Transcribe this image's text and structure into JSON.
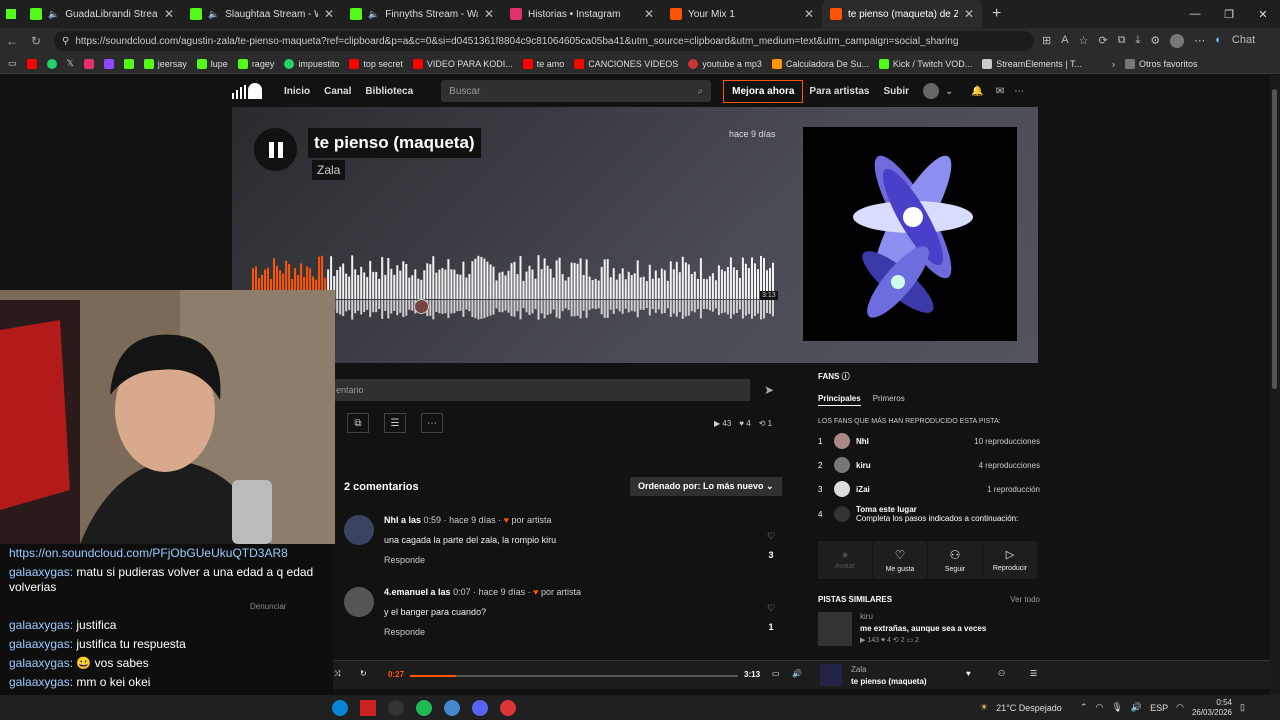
{
  "tabs": [
    {
      "label": "GuadaLibrandi Stream - Watch",
      "color": "#53fc18"
    },
    {
      "label": "Slaughtaa Stream - Watch Liv",
      "color": "#53fc18"
    },
    {
      "label": "Finnyths Stream - Watch Live",
      "color": "#53fc18"
    },
    {
      "label": "Historias • Instagram",
      "color": "#e1306c"
    },
    {
      "label": "Your Mix 1",
      "color": "#ff5500"
    },
    {
      "label": "te pienso (maqueta) de Zala",
      "color": "#ff5500"
    }
  ],
  "url": "https://soundcloud.com/agustin-zala/te-pienso-maqueta?ref=clipboard&p=a&c=0&si=d0451361f8804c9c81064605ca05ba41&utm_source=clipboard&utm_medium=text&utm_campaign=social_sharing",
  "bookmarks": [
    "jeersay",
    "lupe",
    "ragey",
    "impuestito",
    "top secret",
    "VIDEO PARA KODI...",
    "te amo",
    "CANCIONES VIDEOS",
    "youtube a mp3",
    "Calculadora De Su...",
    "Kick / Twitch VOD...",
    "StreamElements | T...",
    "Otros favoritos"
  ],
  "sc_nav": {
    "inicio": "Inicio",
    "canal": "Canal",
    "biblioteca": "Biblioteca",
    "search_placeholder": "Buscar",
    "mejora": "Mejora ahora",
    "para_artistas": "Para artistas",
    "subir": "Subir"
  },
  "track": {
    "title": "te pienso (maqueta)",
    "artist": "Zala",
    "ago": "hace 9 días",
    "duration": "3:13",
    "current": "0:27",
    "progress_fraction": 0.14
  },
  "comment_input": "entario",
  "stats": {
    "plays": "43",
    "likes": "4",
    "reposts": "1"
  },
  "comments_header": "2 comentarios",
  "sort": "Ordenado por: Lo más nuevo",
  "comments": [
    {
      "user": "Nhl a las",
      "time": "0:59",
      "ago": "hace 9 días",
      "badge": "por artista",
      "text": "una cagada la parte del zala, la rompio kiru",
      "reply": "Responde",
      "likes": "3"
    },
    {
      "user": "4.emanuel a las",
      "time": "0:07",
      "ago": "hace 9 días",
      "badge": "por artista",
      "text": "y el banger para cuando?",
      "reply": "Responde",
      "likes": "1"
    }
  ],
  "fans": {
    "title": "FANS",
    "tab1": "Principales",
    "tab2": "Primeros",
    "subtitle": "LOS FANS QUE MÁS HAN REPRODUCIDO ESTA PISTA:",
    "list": [
      {
        "n": "1",
        "name": "Nhl",
        "plays": "10 reproducciones"
      },
      {
        "n": "2",
        "name": "kiru",
        "plays": "4 reproducciones"
      },
      {
        "n": "3",
        "name": "iZai",
        "plays": "1 reproducción"
      }
    ],
    "slot4_title": "Toma este lugar",
    "slot4_sub": "Completa los pasos indicados a continuación:",
    "actions": [
      "Avatar",
      "Me gusta",
      "Seguir",
      "Reproducir"
    ]
  },
  "similares": {
    "title": "PISTAS SIMILARES",
    "ver": "Ver todo",
    "artist": "kiru",
    "track": "me extrañas, aunque sea a veces",
    "stats": "▶ 143  ♥ 4  ⟲ 2  ▭ 2"
  },
  "player": {
    "artist": "Zala",
    "title": "te pienso (maqueta)"
  },
  "chat": [
    {
      "user": "",
      "msg": "https://on.soundcloud.com/PFjObGUeUkuQTD3AR8"
    },
    {
      "user": "galaaxygas:",
      "msg": "matu si pudieras volver a una edad a q edad volverias"
    },
    {
      "user": "galaaxygas:",
      "msg": "justifica"
    },
    {
      "user": "galaaxygas:",
      "msg": "justifica tu respuesta"
    },
    {
      "user": "galaaxygas:",
      "msg": "😀 vos sabes"
    },
    {
      "user": "galaaxygas:",
      "msg": "mm o kei okei"
    }
  ],
  "chat_extra": "Denunciar",
  "taskbar": {
    "weather": "21°C  Despejado",
    "lang": "ESP",
    "time": "0:54",
    "date": "26/03/2026"
  },
  "chrome_chat": "Chat"
}
